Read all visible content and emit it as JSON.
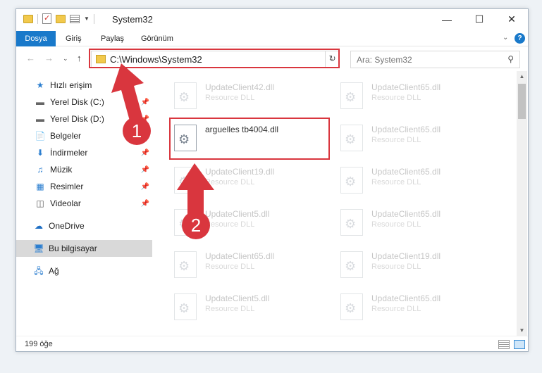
{
  "window": {
    "title": "System32"
  },
  "ribbon": {
    "tabs": [
      "Dosya",
      "Giriş",
      "Paylaş",
      "Görünüm"
    ],
    "help": "?"
  },
  "address": {
    "path": "C:\\Windows\\System32"
  },
  "search": {
    "placeholder": "Ara: System32"
  },
  "sidebar": {
    "items": [
      {
        "label": "Hızlı erişim",
        "icon": "star-icon"
      },
      {
        "label": "Yerel Disk (C:)",
        "icon": "drive-icon",
        "pinned": true
      },
      {
        "label": "Yerel Disk (D:)",
        "icon": "drive-icon",
        "pinned": true
      },
      {
        "label": "Belgeler",
        "icon": "documents-icon"
      },
      {
        "label": "İndirmeler",
        "icon": "download-icon",
        "pinned": true
      },
      {
        "label": "Müzik",
        "icon": "music-icon",
        "pinned": true
      },
      {
        "label": "Resimler",
        "icon": "pictures-icon",
        "pinned": true
      },
      {
        "label": "Videolar",
        "icon": "video-icon",
        "pinned": true
      },
      {
        "label": "OneDrive",
        "icon": "cloud-icon"
      },
      {
        "label": "Bu bilgisayar",
        "icon": "computer-icon",
        "selected": true
      },
      {
        "label": "Ağ",
        "icon": "network-icon"
      }
    ]
  },
  "files": [
    {
      "name": "UpdateClient42.dll",
      "type": "Resource DLL"
    },
    {
      "name": "UpdateClient65.dll",
      "type": "Resource DLL"
    },
    {
      "name": "arguelles tb4004.dll",
      "type": "",
      "highlighted": true
    },
    {
      "name": "UpdateClient65.dll",
      "type": "Resource DLL"
    },
    {
      "name": "UpdateClient19.dll",
      "type": "Resource DLL"
    },
    {
      "name": "UpdateClient65.dll",
      "type": "Resource DLL"
    },
    {
      "name": "UpdateClient5.dll",
      "type": "Resource DLL"
    },
    {
      "name": "UpdateClient65.dll",
      "type": "Resource DLL"
    },
    {
      "name": "UpdateClient65.dll",
      "type": "Resource DLL"
    },
    {
      "name": "UpdateClient19.dll",
      "type": "Resource DLL"
    },
    {
      "name": "UpdateClient5.dll",
      "type": "Resource DLL"
    },
    {
      "name": "UpdateClient65.dll",
      "type": "Resource DLL"
    }
  ],
  "status": {
    "count": "199 öğe"
  },
  "annotations": {
    "step1": "1",
    "step2": "2",
    "color": "#d9363e"
  }
}
